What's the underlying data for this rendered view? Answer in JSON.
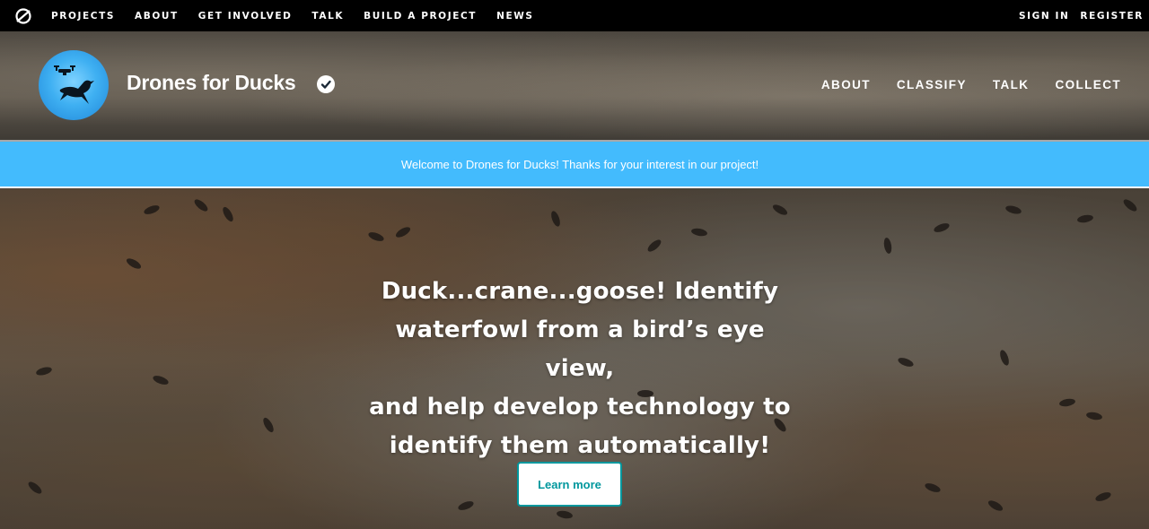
{
  "top_nav": {
    "logo_icon": "zooniverse-logo-icon",
    "items": [
      "PROJECTS",
      "ABOUT",
      "GET INVOLVED",
      "TALK",
      "BUILD A PROJECT",
      "NEWS"
    ],
    "sign_in": "SIGN IN",
    "register": "REGISTER"
  },
  "project": {
    "title": "Drones for Ducks",
    "verified_icon": "check-circle-icon",
    "nav": [
      "ABOUT",
      "CLASSIFY",
      "TALK",
      "COLLECT"
    ]
  },
  "announcement": {
    "text": "Welcome to Drones for Ducks! Thanks for your interest in our project!",
    "color": "#43bbfd"
  },
  "hero": {
    "lines": [
      "Duck...crane...goose! Identify",
      "waterfowl from a bird’s eye view,",
      "and help develop technology to",
      "identify them automatically!"
    ],
    "button": "Learn more",
    "button_color": "#00979d"
  }
}
